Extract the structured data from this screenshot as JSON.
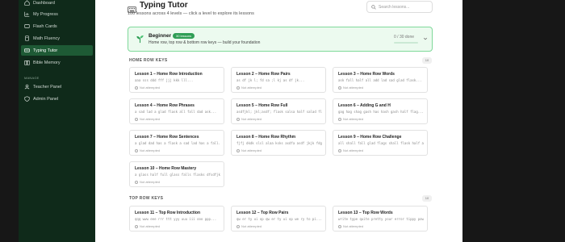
{
  "sidebar": {
    "items": [
      {
        "label": "Dashboard",
        "icon": "home-icon"
      },
      {
        "label": "My Progress",
        "icon": "chart-icon"
      },
      {
        "label": "Flash Cards",
        "icon": "cards-icon"
      },
      {
        "label": "Math Fluency",
        "icon": "calculator-icon"
      },
      {
        "label": "Typing Tutor",
        "icon": "keyboard-icon",
        "active": true
      },
      {
        "label": "Bible Memory",
        "icon": "book-icon"
      }
    ],
    "manage_label": "MANAGE",
    "manage_items": [
      {
        "label": "Teacher Panel",
        "icon": "user-icon"
      },
      {
        "label": "Admin Panel",
        "icon": "shield-icon"
      }
    ]
  },
  "header": {
    "title": "Typing Tutor",
    "subtitle": "100 lessons across 4 levels — click a level to explore its lessons",
    "search_placeholder": "Search lessons..."
  },
  "level": {
    "name": "Beginner",
    "badge": "30 lessons",
    "description": "Home row, top row & bottom row keys — build your foundation",
    "progress": "0 / 30 done",
    "progress_fraction": 0
  },
  "sections": [
    {
      "title": "HOME ROW KEYS",
      "count": "10",
      "lessons": [
        {
          "title": "Lesson 1 – Home Row Introduction",
          "preview": "aaa sss ddd fff jjj kkk lll...",
          "status": "Not attempted"
        },
        {
          "title": "Lesson 2 – Home Row Pairs",
          "preview": "as df jk l; fd sa ;l kj as df jk...",
          "status": "Not attempted"
        },
        {
          "title": "Lesson 3 – Home Row Words",
          "preview": "ask fall half all add lad sad glad flask...",
          "status": "Not attempted"
        },
        {
          "title": "Lesson 4 – Home Row Phrases",
          "preview": "a sad lad a glad flask all fall dad ask...",
          "status": "Not attempted"
        },
        {
          "title": "Lesson 5 – Home Row Full",
          "preview": "asdfjkl; jkl;asdf; flask salsa half salad flask alfalfa...",
          "status": "Not attempted"
        },
        {
          "title": "Lesson 6 – Adding G and H",
          "preview": "gag hag shag gash has hash gash half flag...",
          "status": "Not attempted"
        },
        {
          "title": "Lesson 7 – Home Row Sentences",
          "preview": "a glad dad has a flask a sad lad has a fall...",
          "status": "Not attempted"
        },
        {
          "title": "Lesson 8 – Home Row Rhythm",
          "preview": "fjfj dkdk slsl alaa ksks asdfa asdf jkjk fdgs gsdfa...",
          "status": "Not attempted"
        },
        {
          "title": "Lesson 9 – Home Row Challenge",
          "preview": "all shall fall glad flags shall flask half a salad flask...",
          "status": "Not attempted"
        },
        {
          "title": "Lesson 10 – Home Row Mastery",
          "preview": "a glass half full glass falls flasks dfsdfjkl flags shal...",
          "status": "Not attempted"
        }
      ]
    },
    {
      "title": "TOP ROW KEYS",
      "count": "10",
      "lessons": [
        {
          "title": "Lesson 11 – Top Row Introduction",
          "preview": "qqq www eee rrr ttt yyy uuu iii ooo ppp...",
          "status": "Not attempted"
        },
        {
          "title": "Lesson 12 – Top Row Pairs",
          "preview": "qw er ty ui op qw er ty ui op we ry to pi...",
          "status": "Not attempted"
        },
        {
          "title": "Lesson 13 – Top Row Words",
          "preview": "write type quite pretty your error tippy power ...",
          "status": "Not attempted"
        }
      ]
    }
  ],
  "colors": {
    "sidebar_bg": "#0f2a1a",
    "sidebar_active": "#1e5a35",
    "accent": "#2f9e55",
    "level_bg": "#ecfaef",
    "level_border": "#7fd99a"
  }
}
